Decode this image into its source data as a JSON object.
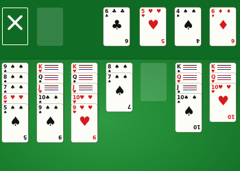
{
  "game": {
    "close_label": "close",
    "colors": {
      "felt": "#218a35",
      "felt_top": "#0f6a23",
      "red": "#d51a1a",
      "black": "#111111"
    },
    "foundations": [
      {
        "rank": "6",
        "suit": "♣",
        "color": "black",
        "label": "6"
      },
      {
        "rank": "5",
        "suit": "♥",
        "color": "red",
        "label": "5"
      },
      {
        "rank": "4",
        "suit": "♠",
        "color": "black",
        "label": "4"
      },
      {
        "rank": "6",
        "suit": "♦",
        "color": "red",
        "label": "6"
      }
    ],
    "columns": [
      {
        "cards": [
          {
            "rank": "9",
            "suit": "♠",
            "color": "black"
          },
          {
            "rank": "8",
            "suit": "♠",
            "color": "black"
          },
          {
            "rank": "7",
            "suit": "♠",
            "color": "black"
          },
          {
            "rank": "6",
            "suit": "♥",
            "color": "red"
          },
          {
            "rank": "5",
            "suit": "♠",
            "color": "black"
          }
        ]
      },
      {
        "cards": [
          {
            "rank": "K",
            "suit": "♥",
            "color": "red"
          },
          {
            "rank": "Q",
            "suit": "♠",
            "color": "black"
          },
          {
            "rank": "J",
            "suit": "♥",
            "color": "red"
          },
          {
            "rank": "10",
            "suit": "♠",
            "color": "black"
          },
          {
            "rank": "9",
            "suit": "♠",
            "color": "black"
          }
        ]
      },
      {
        "cards": [
          {
            "rank": "K",
            "suit": "♥",
            "color": "red"
          },
          {
            "rank": "Q",
            "suit": "♠",
            "color": "black"
          },
          {
            "rank": "J",
            "suit": "♥",
            "color": "red"
          },
          {
            "rank": "10",
            "suit": "♥",
            "color": "red"
          },
          {
            "rank": "9",
            "suit": "♥",
            "color": "red"
          }
        ]
      },
      {
        "cards": [
          {
            "rank": "8",
            "suit": "♠",
            "color": "black"
          },
          {
            "rank": "7",
            "suit": "♠",
            "color": "black"
          }
        ]
      },
      {
        "cards": []
      },
      {
        "cards": [
          {
            "rank": "K",
            "suit": "♠",
            "color": "black"
          },
          {
            "rank": "Q",
            "suit": "♥",
            "color": "red"
          },
          {
            "rank": "J",
            "suit": "♠",
            "color": "black"
          },
          {
            "rank": "10",
            "suit": "♠",
            "color": "black"
          }
        ]
      },
      {
        "cards": [
          {
            "rank": "K",
            "suit": "♥",
            "color": "red"
          },
          {
            "rank": "Q",
            "suit": "♥",
            "color": "red"
          },
          {
            "rank": "10",
            "suit": "♥",
            "color": "red"
          }
        ]
      }
    ]
  }
}
